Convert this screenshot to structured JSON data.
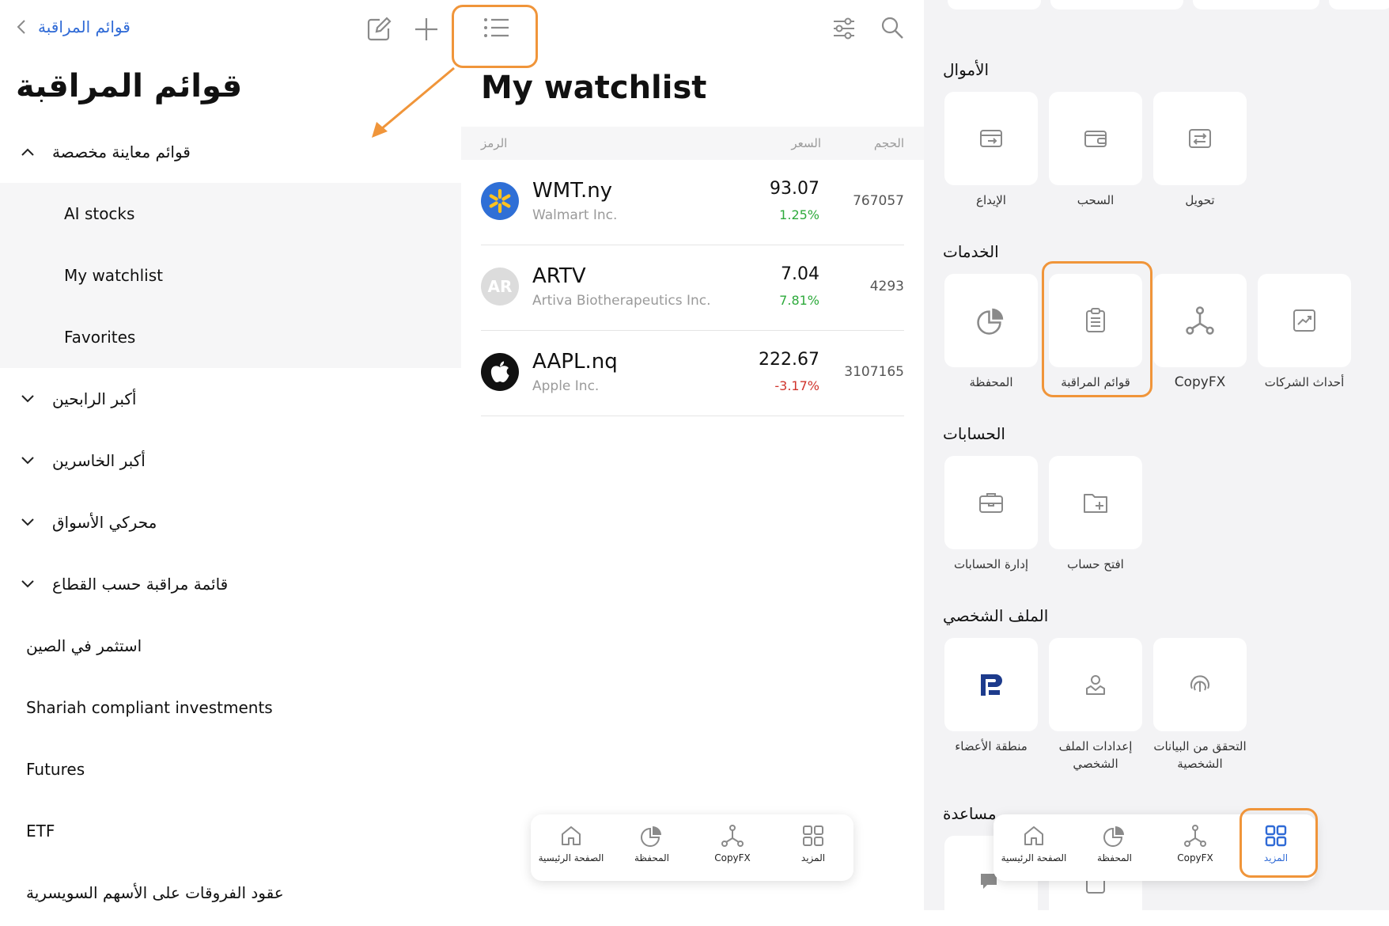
{
  "watchlists_panel": {
    "back_label": "قوائم المراقبة",
    "title": "قوائم المراقبة",
    "custom_section": "قوائم معاينة مخصصة",
    "custom_items": [
      "AI stocks",
      "My watchlist",
      "Favorites"
    ],
    "collapsible_sections": [
      "أكبر الرابحين",
      "أكبر الخاسرين",
      "محركي الأسواق",
      "قائمة مراقبة حسب القطاع"
    ],
    "flat_items": [
      "استثمر في الصين",
      "Shariah compliant investments",
      "Futures",
      "ETF",
      "عقود الفروقات على الأسهم السويسرية"
    ]
  },
  "watchlist": {
    "title": "My watchlist",
    "columns": {
      "symbol": "الرمز",
      "price": "السعر",
      "volume": "الحجم"
    },
    "rows": [
      {
        "symbol": "WMT.ny",
        "name": "Walmart Inc.",
        "price": "93.07",
        "change": "1.25%",
        "direction": "up",
        "volume": "767057",
        "logo": "walmart-spark-icon"
      },
      {
        "symbol": "ARTV",
        "name": "Artiva Biotherapeutics Inc.",
        "price": "7.04",
        "change": "7.81%",
        "direction": "up",
        "volume": "4293",
        "logo_text": "AR"
      },
      {
        "symbol": "AAPL.nq",
        "name": "Apple Inc.",
        "price": "222.67",
        "change": "-3.17%",
        "direction": "down",
        "volume": "3107165",
        "logo": "apple-icon"
      }
    ]
  },
  "tabbar": {
    "home": "الصفحة الرئيسية",
    "portfolio": "المحفظة",
    "copyfx": "CopyFX",
    "more": "المزيد"
  },
  "more_panel": {
    "funds": {
      "title": "الأموال",
      "items": [
        "الإيداع",
        "السحب",
        "تحويل"
      ]
    },
    "services": {
      "title": "الخدمات",
      "items": [
        "المحفظة",
        "قوائم المراقبة",
        "CopyFX",
        "أحداث الشركات"
      ]
    },
    "accounts": {
      "title": "الحسابات",
      "items": [
        "إدارة الحسابات",
        "افتح حساب"
      ]
    },
    "profile": {
      "title": "الملف الشخصي",
      "items": [
        "منطقة الأعضاء",
        "إعدادات الملف الشخصي",
        "التحقق من البيانات الشخصية"
      ]
    },
    "help": {
      "title": "مساعدة"
    }
  },
  "colors": {
    "accent_blue": "#2f6ad6",
    "highlight_orange": "#f0953a",
    "up_green": "#2eaa3c",
    "down_red": "#d0342c",
    "walmart_blue": "#2f6fd6",
    "walmart_yellow": "#ffc220"
  }
}
